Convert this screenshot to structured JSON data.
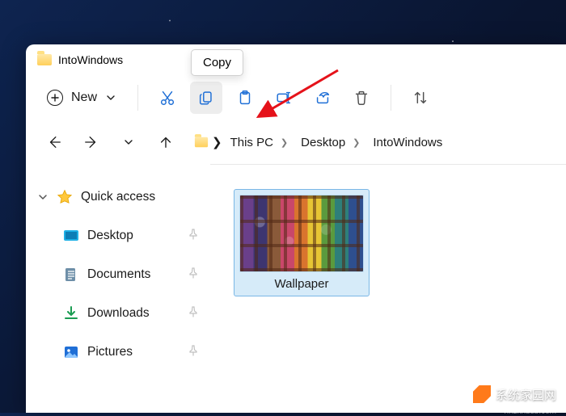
{
  "window": {
    "title": "IntoWindows"
  },
  "toolbar": {
    "new_label": "New",
    "tooltip_copy": "Copy"
  },
  "breadcrumbs": {
    "items": [
      "This PC",
      "Desktop",
      "IntoWindows"
    ]
  },
  "sidebar": {
    "quick_access": "Quick access",
    "items": [
      {
        "label": "Desktop"
      },
      {
        "label": "Documents"
      },
      {
        "label": "Downloads"
      },
      {
        "label": "Pictures"
      }
    ]
  },
  "content": {
    "files": [
      {
        "label": "Wallpaper"
      }
    ]
  },
  "watermark": {
    "text": "系统家园网",
    "sub": "hnzkhbsb.com"
  }
}
